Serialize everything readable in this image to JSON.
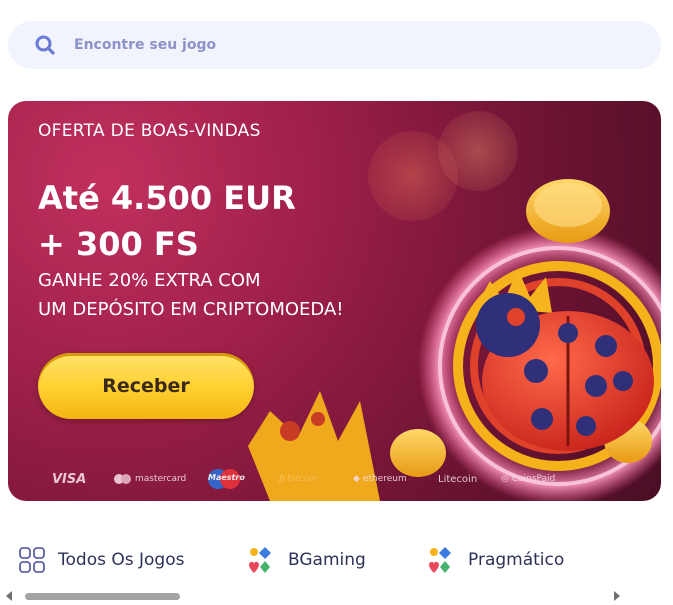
{
  "search": {
    "placeholder": "Encontre seu jogo"
  },
  "banner": {
    "kicker": "OFERTA DE BOAS-VINDAS",
    "headline_line1": "Até 4.500 EUR",
    "headline_line2": "+ 300 FS",
    "subline_line1": "GANHE 20% EXTRA COM",
    "subline_line2": "UM DEPÓSITO EM CRIPTOMOEDA!",
    "cta_label": "Receber",
    "payments": [
      "VISA",
      "mastercard",
      "Maestro",
      "bitcoin",
      "ethereum",
      "Litecoin",
      "CoinsPaid"
    ]
  },
  "categories": [
    {
      "label": "Todos Os Jogos",
      "icon": "grid-icon"
    },
    {
      "label": "BGaming",
      "icon": "card-suits-icon"
    },
    {
      "label": "Pragmático",
      "icon": "card-suits-icon"
    }
  ],
  "colors": {
    "banner_bg": "#9b1f47",
    "cta": "#ffcf2f",
    "search_bg": "#f1f4fd",
    "search_icon": "#6b7bd6"
  }
}
